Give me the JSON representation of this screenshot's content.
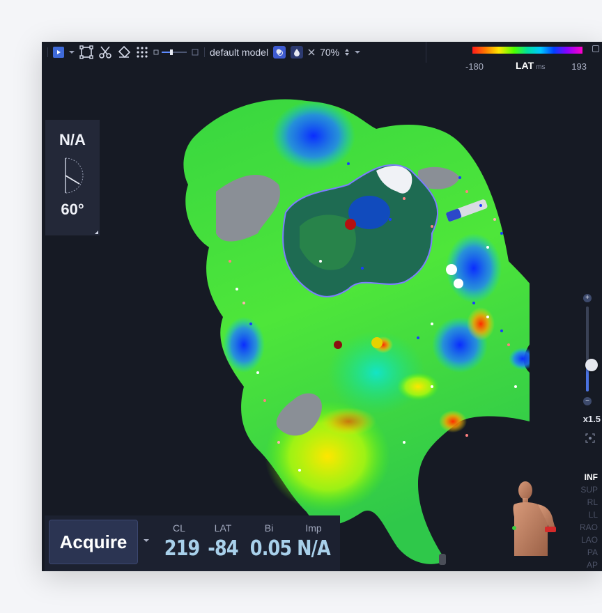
{
  "toolbar": {
    "model_name": "default model",
    "zoom_percent": "70%",
    "icons": [
      "play-icon",
      "chevron-down-icon",
      "select-box-icon",
      "scissors-icon",
      "eraser-icon",
      "grid-dots-icon",
      "slider-icon",
      "layers-icon",
      "opacity-icon",
      "fit-icon",
      "spinner-icon"
    ]
  },
  "lat_scale": {
    "min": "-180",
    "max": "193",
    "label": "LAT",
    "unit": "ms",
    "gradient": [
      "#ff1a1a",
      "#ff7b00",
      "#ffe600",
      "#4cff00",
      "#00e0a0",
      "#00c8ff",
      "#0040ff",
      "#8a00ff",
      "#ff00c8"
    ]
  },
  "angle_panel": {
    "top_value": "N/A",
    "bottom_value": "60°"
  },
  "zoom": {
    "level": "x1.5",
    "slider_fraction": 0.72
  },
  "views": {
    "items": [
      "INF",
      "SUP",
      "RL",
      "LL",
      "RAO",
      "LAO",
      "PA",
      "AP"
    ],
    "active": "INF"
  },
  "acquire": {
    "label": "Acquire"
  },
  "metrics": [
    {
      "label": "CL",
      "value": "219"
    },
    {
      "label": "LAT",
      "value": "-84"
    },
    {
      "label": "Bi",
      "value": "0.05"
    },
    {
      "label": "Imp",
      "value": "N/A"
    }
  ],
  "colors": {
    "background": "#161a24",
    "accent": "#3f6ad8",
    "metric_value": "#a8d0ea"
  }
}
